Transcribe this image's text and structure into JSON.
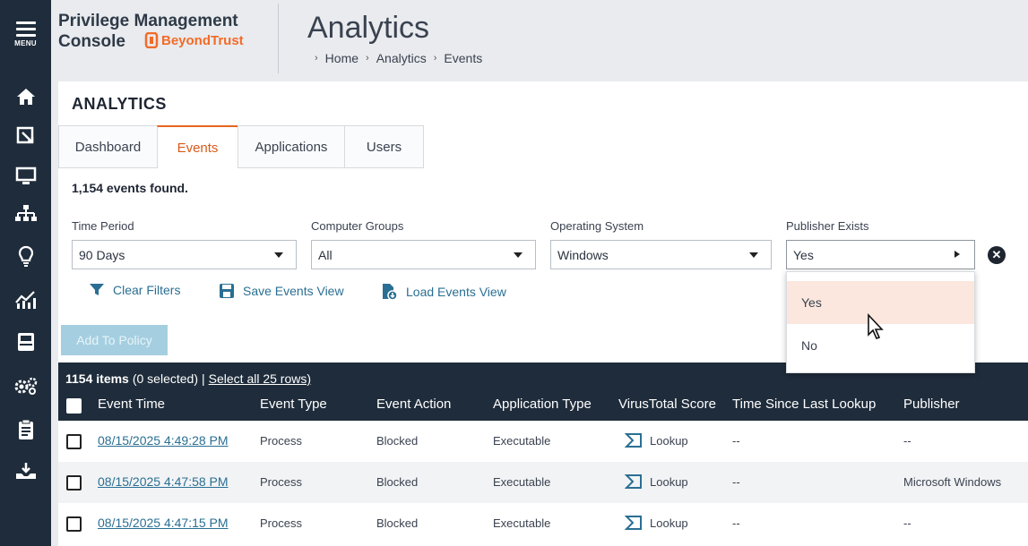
{
  "nav": {
    "menu_label": "MENU",
    "items": [
      "home-icon",
      "policy-icon",
      "computer-icon",
      "hierarchy-icon",
      "lightbulb-icon",
      "analytics-icon",
      "inbox-icon",
      "settings-icon",
      "clipboard-icon",
      "deploy-icon"
    ]
  },
  "header": {
    "brand_line1": "Privilege Management",
    "brand_line2": "Console",
    "brand_logo_text": "BeyondTrust",
    "page_title": "Analytics",
    "breadcrumb": [
      "Home",
      "Analytics",
      "Events"
    ]
  },
  "main": {
    "heading": "ANALYTICS",
    "tabs": [
      {
        "label": "Dashboard",
        "active": false
      },
      {
        "label": "Events",
        "active": true
      },
      {
        "label": "Applications",
        "active": false
      },
      {
        "label": "Users",
        "active": false
      }
    ],
    "found_text": "1,154 events found.",
    "filters": [
      {
        "label": "Time Period",
        "value": "90 Days"
      },
      {
        "label": "Computer Groups",
        "value": "All"
      },
      {
        "label": "Operating System",
        "value": "Windows"
      },
      {
        "label": "Publisher Exists",
        "value": "Yes"
      }
    ],
    "actions": {
      "clear_filters": "Clear Filters",
      "save_view": "Save Events View",
      "load_view": "Load Events View"
    },
    "add_to_policy": "Add To Policy",
    "dropdown_options": [
      "Yes",
      "No"
    ]
  },
  "grid": {
    "count": "1154 items",
    "selected": "(0 selected)",
    "separator": "|",
    "select_all": "Select all 25 rows)",
    "columns": [
      "Event Time",
      "Event Type",
      "Event Action",
      "Application Type",
      "VirusTotal Score",
      "Time Since Last Lookup",
      "Publisher"
    ],
    "rows": [
      {
        "time": "08/15/2025 4:49:28 PM",
        "type": "Process",
        "action": "Blocked",
        "app_type": "Executable",
        "vt": "Lookup",
        "since": "--",
        "publisher": "--"
      },
      {
        "time": "08/15/2025 4:47:58 PM",
        "type": "Process",
        "action": "Blocked",
        "app_type": "Executable",
        "vt": "Lookup",
        "since": "--",
        "publisher": "Microsoft Windows"
      },
      {
        "time": "08/15/2025 4:47:15 PM",
        "type": "Process",
        "action": "Blocked",
        "app_type": "Executable",
        "vt": "Lookup",
        "since": "--",
        "publisher": "--"
      }
    ]
  },
  "colors": {
    "rail": "#1f2c3b",
    "accent": "#e5651f",
    "link": "#2a6f93"
  }
}
